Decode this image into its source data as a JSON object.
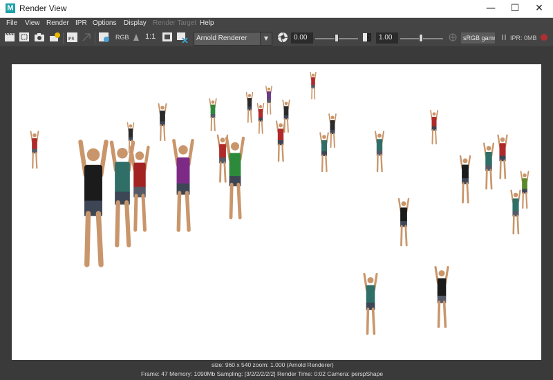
{
  "window": {
    "title": "Render View",
    "minimize": "—",
    "maximize": "☐",
    "close": "✕"
  },
  "menu": [
    "File",
    "View",
    "Render",
    "IPR",
    "Options",
    "Display",
    "Render Target",
    "Help"
  ],
  "toolbar": {
    "rgb_label": "RGB",
    "one_to_one": "1:1",
    "renderer": "Arnold Renderer",
    "exposure": "0.00",
    "gamma": "1.00",
    "colorspace": "sRGB gamma",
    "ipr_memory": "IPR: 0MB"
  },
  "status": {
    "line1": "size:  960 x 540  zoom: 1.000      (Arnold Renderer)",
    "line2": "Frame: 47      Memory: 1090Mb      Sampling: [3/2/2/2/2/2]      Render Time: 0:02      Camera: perspShape"
  },
  "colors": {
    "accent": "#1da1a8",
    "background": "#444444",
    "render_bg": "#ffffff"
  }
}
